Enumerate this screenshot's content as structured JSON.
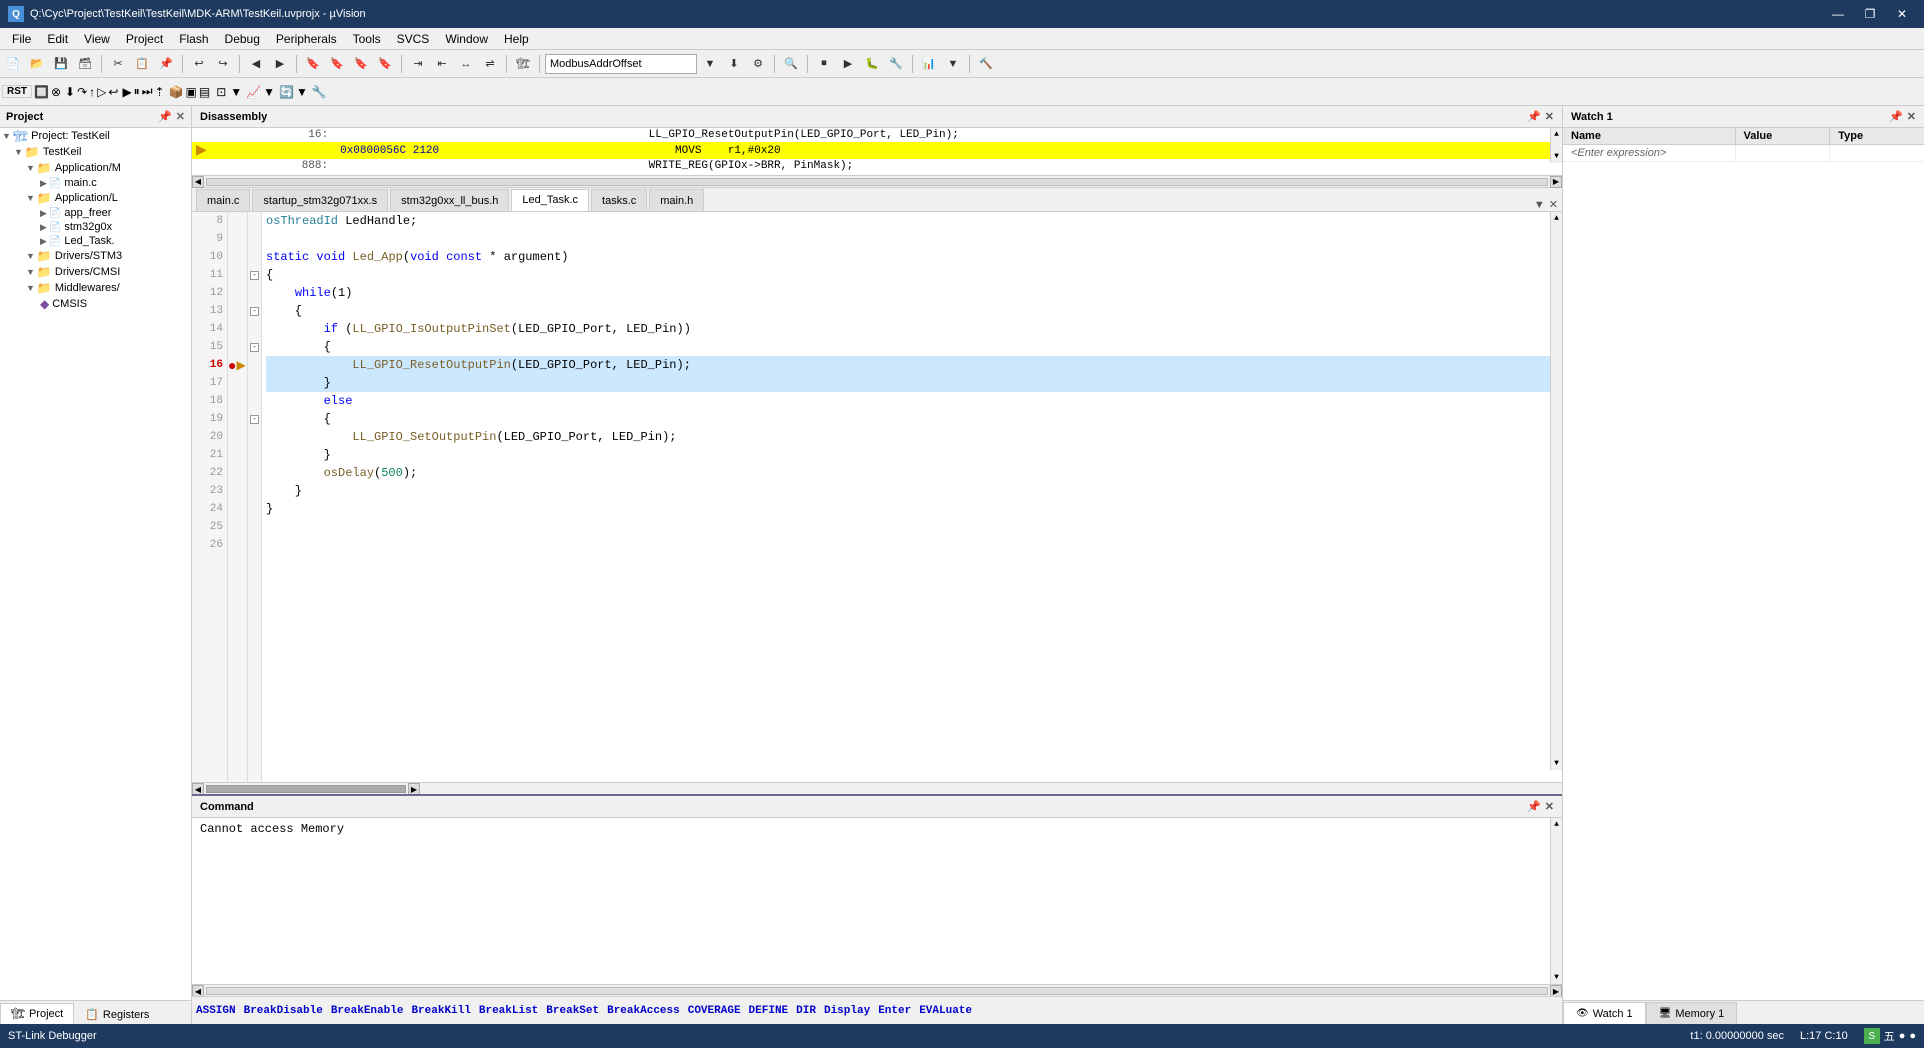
{
  "titlebar": {
    "icon": "Q",
    "title": "Q:\\Cyc\\Project\\TestKeil\\TestKeil\\MDK-ARM\\TestKeil.uvprojx - µVision",
    "minimize": "—",
    "maximize": "❐",
    "close": "✕"
  },
  "menubar": {
    "items": [
      "File",
      "Edit",
      "View",
      "Project",
      "Flash",
      "Debug",
      "Peripherals",
      "Tools",
      "SVCS",
      "Window",
      "Help"
    ]
  },
  "toolbar1": {
    "combo_value": "ModbusAddrOffset"
  },
  "project_panel": {
    "title": "Project",
    "tree": [
      {
        "indent": 0,
        "type": "root",
        "icon": "▼",
        "label": "Project: TestKeil",
        "has_expand": true
      },
      {
        "indent": 1,
        "type": "group",
        "icon": "▼",
        "label": "TestKeil",
        "has_expand": true
      },
      {
        "indent": 2,
        "type": "folder",
        "icon": "▼",
        "label": "Application/M",
        "has_expand": true
      },
      {
        "indent": 3,
        "type": "file",
        "icon": "📄",
        "label": "main.c"
      },
      {
        "indent": 2,
        "type": "folder",
        "icon": "▼",
        "label": "Application/L",
        "has_expand": true
      },
      {
        "indent": 3,
        "type": "file",
        "icon": "📄",
        "label": "app_freer"
      },
      {
        "indent": 3,
        "type": "file",
        "icon": "📄",
        "label": "stm32g0x"
      },
      {
        "indent": 3,
        "type": "file",
        "icon": "📄",
        "label": "Led_Task."
      },
      {
        "indent": 2,
        "type": "folder",
        "icon": "▼",
        "label": "Drivers/STM3",
        "has_expand": true
      },
      {
        "indent": 2,
        "type": "folder",
        "icon": "▼",
        "label": "Drivers/CMSI",
        "has_expand": true
      },
      {
        "indent": 2,
        "type": "folder",
        "icon": "▼",
        "label": "Middlewares/",
        "has_expand": true
      },
      {
        "indent": 3,
        "type": "component",
        "icon": "◆",
        "label": "CMSIS"
      }
    ],
    "tabs": [
      "Project",
      "Registers"
    ]
  },
  "disasm": {
    "title": "Disassembly",
    "lines": [
      {
        "num": "16:",
        "addr": "",
        "code": "    LL_GPIO_ResetOutputPin(LED_GPIO_Port, LED_Pin);",
        "current": false
      },
      {
        "num": "",
        "addr": "0x0800056C 2120",
        "code": "    MOVS    r1,#0x20",
        "current": true
      },
      {
        "num": "888:",
        "addr": "",
        "code": "    WRITE_REG(GPIOx->BRR, PinMask);",
        "current": false
      }
    ]
  },
  "editor": {
    "tabs": [
      {
        "label": "main.c",
        "active": false,
        "dirty": false
      },
      {
        "label": "startup_stm32g071xx.s",
        "active": false,
        "dirty": false
      },
      {
        "label": "stm32g0xx_ll_bus.h",
        "active": false,
        "dirty": false
      },
      {
        "label": "Led_Task.c",
        "active": true,
        "dirty": false
      },
      {
        "label": "tasks.c",
        "active": false,
        "dirty": false
      },
      {
        "label": "main.h",
        "active": false,
        "dirty": false
      }
    ],
    "lines": [
      {
        "num": 8,
        "gutter": "",
        "text": "osThreadId LedHandle;",
        "indent": 0
      },
      {
        "num": 9,
        "gutter": "",
        "text": "",
        "indent": 0
      },
      {
        "num": 10,
        "gutter": "",
        "text": "static void Led_App(void const * argument)",
        "indent": 0,
        "type": "signature"
      },
      {
        "num": 11,
        "gutter": "□",
        "text": "{",
        "indent": 0
      },
      {
        "num": 12,
        "gutter": "",
        "text": "    while(1)",
        "indent": 4
      },
      {
        "num": 13,
        "gutter": "□",
        "text": "    {",
        "indent": 4
      },
      {
        "num": 14,
        "gutter": "",
        "text": "        if (LL_GPIO_IsOutputPinSet(LED_GPIO_Port, LED_Pin))",
        "indent": 8,
        "type": "if"
      },
      {
        "num": 15,
        "gutter": "□",
        "text": "        {",
        "indent": 8
      },
      {
        "num": 16,
        "gutter": "●▶",
        "text": "            LL_GPIO_ResetOutputPin(LED_GPIO_Port, LED_Pin);",
        "indent": 12,
        "current": true
      },
      {
        "num": 17,
        "gutter": "",
        "text": "        }",
        "indent": 8
      },
      {
        "num": 18,
        "gutter": "",
        "text": "        else",
        "indent": 8,
        "type": "else"
      },
      {
        "num": 19,
        "gutter": "□",
        "text": "        {",
        "indent": 8
      },
      {
        "num": 20,
        "gutter": "",
        "text": "            LL_GPIO_SetOutputPin(LED_GPIO_Port, LED_Pin);",
        "indent": 12
      },
      {
        "num": 21,
        "gutter": "",
        "text": "        }",
        "indent": 8
      },
      {
        "num": 22,
        "gutter": "",
        "text": "        osDelay(500);",
        "indent": 8
      },
      {
        "num": 23,
        "gutter": "",
        "text": "    }",
        "indent": 4
      },
      {
        "num": 24,
        "gutter": "",
        "text": "}",
        "indent": 0
      },
      {
        "num": 25,
        "gutter": "",
        "text": "",
        "indent": 0
      },
      {
        "num": 26,
        "gutter": "",
        "text": "",
        "indent": 0
      }
    ]
  },
  "watch1": {
    "title": "Watch 1",
    "columns": [
      "Name",
      "Value",
      "Type"
    ],
    "placeholder": "<Enter expression>"
  },
  "command": {
    "title": "Command",
    "output": "Cannot access Memory",
    "prompt": ">",
    "keywords": [
      "ASSIGN",
      "BreakDisable",
      "BreakEnable",
      "BreakKill",
      "BreakList",
      "BreakSet",
      "BreakAccess",
      "COVERAGE",
      "DEFINE",
      "DIR",
      "Display",
      "Enter",
      "EVALuate"
    ]
  },
  "bottom_tabs": [
    {
      "label": "Watch 1",
      "active": true
    },
    {
      "label": "Memory 1",
      "active": false
    }
  ],
  "statusbar": {
    "debugger": "ST-Link Debugger",
    "time": "t1: 0.00000000 sec",
    "cursor": "L:17 C:10"
  }
}
